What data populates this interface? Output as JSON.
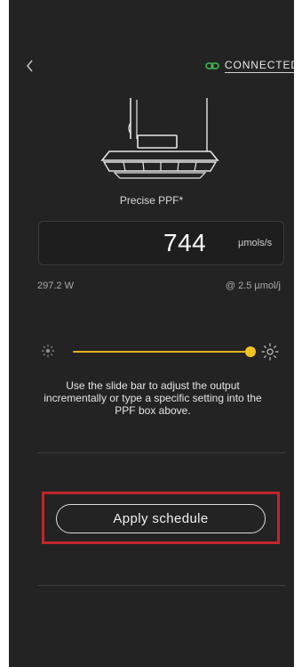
{
  "header": {
    "status_label": "CONNECTED",
    "status_color": "#3fb950"
  },
  "fixture": {
    "icon": "grow-light-fixture-icon"
  },
  "ppf": {
    "label": "Precise PPF*",
    "value": "744",
    "unit": "µmols/s"
  },
  "stats": {
    "watts": "297.2 W",
    "efficiency": "@ 2.5 µmol/j"
  },
  "slider": {
    "level_fraction": 1.0,
    "accent_color": "#f3c421",
    "min_icon": "dim-sun-icon",
    "max_icon": "bright-sun-icon"
  },
  "help_text": "Use the slide bar to adjust the output incrementally or type a specific setting into the PPF box above.",
  "actions": {
    "apply_schedule_label": "Apply schedule"
  }
}
